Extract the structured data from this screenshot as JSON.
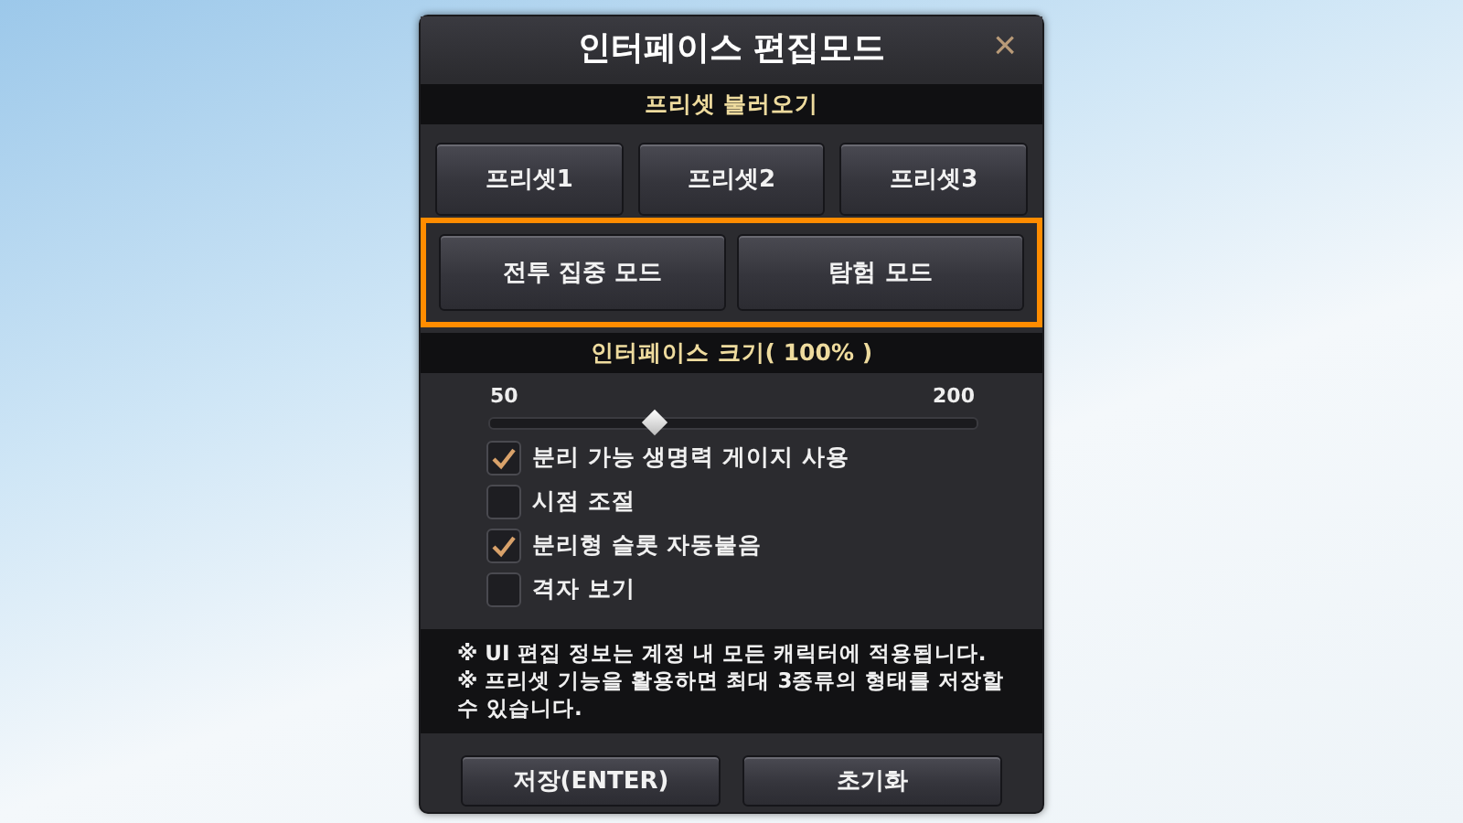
{
  "window": {
    "title": "인터페이스 편집모드",
    "close": "×"
  },
  "preset_section": {
    "title": "프리셋 불러오기",
    "buttons": [
      "프리셋1",
      "프리셋2",
      "프리셋3"
    ]
  },
  "mode_buttons": {
    "highlighted": true,
    "buttons": [
      "전투 집중 모드",
      "탐험 모드"
    ]
  },
  "size_section": {
    "title": "인터페이스 크기( 100% )",
    "min_label": "50",
    "max_label": "200",
    "level": 0.34
  },
  "options": [
    {
      "label": "분리 가능 생명력 게이지 사용",
      "checked": true
    },
    {
      "label": "시점 조절",
      "checked": false
    },
    {
      "label": "분리형 슬롯 자동붙음",
      "checked": true
    },
    {
      "label": "격자 보기",
      "checked": false
    }
  ],
  "notes": [
    "※ UI 편집 정보는 계정 내 모든 캐릭터에 적용됩니다.",
    "※ 프리셋 기능을 활용하면 최대 3종류의 형태를 저장할 수 있습니다."
  ],
  "footer_buttons": [
    "저장(ENTER)",
    "초기화"
  ]
}
